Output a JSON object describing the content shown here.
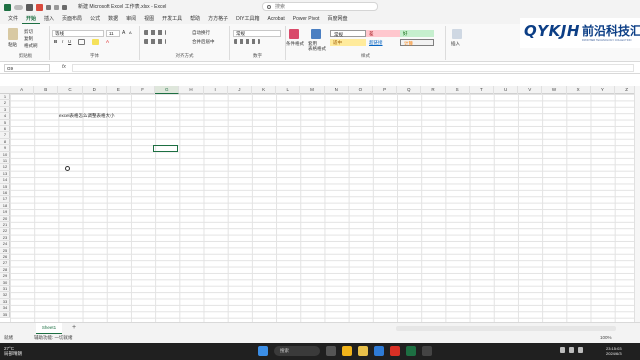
{
  "titlebar": {
    "autosave_label": "自动保存",
    "document_title": "新建 Microsoft Excel 工作表.xlsx  -  Excel",
    "search_placeholder": "搜索"
  },
  "ribbon_tabs": [
    "文件",
    "开始",
    "插入",
    "页面布局",
    "公式",
    "数据",
    "审阅",
    "视图",
    "开发工具",
    "帮助",
    "方方格子",
    "DIY工具箱",
    "Acrobat",
    "Power Pivot",
    "百度网盘"
  ],
  "ribbon": {
    "clipboard": {
      "paste": "粘贴",
      "cut": "剪切",
      "copy": "复制",
      "format_painter": "格式刷",
      "group": "剪贴板"
    },
    "font": {
      "name": "等线",
      "size": "11",
      "group": "字体"
    },
    "alignment": {
      "wrap": "自动换行",
      "merge": "合并后居中",
      "group": "对齐方式"
    },
    "number": {
      "format": "常规",
      "group": "数字"
    },
    "styles": {
      "conditional": "条件格式",
      "table_format": "套用\n表格格式",
      "normal": "常规",
      "bad": "差",
      "good": "好",
      "neutral": "适中",
      "hyperlink": "超链接",
      "calc": "计算",
      "group": "样式"
    },
    "cells": {
      "insert": "插入"
    }
  },
  "brand": {
    "main": "QYKJH",
    "cn": "前沿科技汇",
    "sub": "FRONTIER TECHNOLOGY COLLECTION"
  },
  "formula_bar": {
    "name_box": "G9",
    "fx": "fx",
    "content": ""
  },
  "columns": [
    "A",
    "B",
    "C",
    "D",
    "E",
    "F",
    "G",
    "H",
    "I",
    "J",
    "K",
    "L",
    "M",
    "N",
    "O",
    "P",
    "Q",
    "R",
    "S",
    "T",
    "U",
    "V",
    "W",
    "X",
    "Y",
    "Z"
  ],
  "selected_column": "G",
  "rows": [
    "1",
    "2",
    "3",
    "4",
    "5",
    "6",
    "7",
    "8",
    "9",
    "10",
    "11",
    "12",
    "13",
    "14",
    "15",
    "16",
    "17",
    "18",
    "19",
    "20",
    "21",
    "22",
    "23",
    "24",
    "25",
    "26",
    "27",
    "28",
    "29",
    "30",
    "31",
    "32",
    "33",
    "34",
    "35"
  ],
  "cell_content": {
    "ref": "C4",
    "text": "excel表格怎么调整表格大小"
  },
  "active_cell": "G9",
  "sheets": [
    {
      "name": "Sheet1",
      "active": true
    }
  ],
  "add_sheet": "+",
  "status": {
    "mode": "就绪",
    "accessibility": "辅助功能: 一切就绪",
    "zoom": "100%"
  },
  "taskbar": {
    "weather_temp": "27°C",
    "weather_desc": "局部晴朗",
    "search_label": "搜索",
    "time": "23:15:03",
    "date": "2024/6/3"
  },
  "colors": {
    "excel_green": "#1d6f42",
    "taskbar": "#202020",
    "brand_blue": "#0d3f86"
  }
}
